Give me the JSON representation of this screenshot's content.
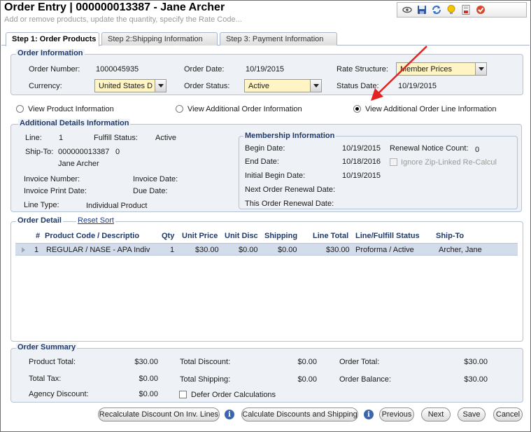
{
  "window": {
    "title": "Order Entry | 000000013387 - Jane Archer",
    "subtitle": "Add or remove products, update the quantity, specify the Rate Code..."
  },
  "toolbar": {
    "icons": [
      "view-icon",
      "save-icon",
      "refresh-icon",
      "lightbulb-icon",
      "report-icon",
      "ok-icon"
    ]
  },
  "tabs": [
    {
      "label": "Step 1: Order Products"
    },
    {
      "label": "Step 2:Shipping Information"
    },
    {
      "label": "Step 3: Payment Information"
    }
  ],
  "order_info": {
    "legend": "Order Information",
    "order_number_label": "Order Number:",
    "order_number": "1000045935",
    "order_date_label": "Order Date:",
    "order_date": "10/19/2015",
    "rate_structure_label": "Rate Structure:",
    "rate_structure": "Member Prices",
    "currency_label": "Currency:",
    "currency": "United States D",
    "order_status_label": "Order Status:",
    "order_status": "Active",
    "status_date_label": "Status Date:",
    "status_date": "10/19/2015"
  },
  "view_options": {
    "product": "View Product Information",
    "additional_order": "View Additional Order Information",
    "additional_line": "View Additional Order Line Information",
    "selected": "additional_line"
  },
  "additional_details": {
    "legend": "Additional Details Information",
    "line_label": "Line:",
    "line": "1",
    "fulfill_status_label": "Fulfill Status:",
    "fulfill_status": "Active",
    "ship_to_label": "Ship-To:",
    "ship_to_id": "000000013387",
    "ship_to_num": "0",
    "ship_to_name": "Jane Archer",
    "invoice_number_label": "Invoice Number:",
    "invoice_date_label": "Invoice Date:",
    "invoice_print_date_label": "Invoice Print Date:",
    "due_date_label": "Due Date:",
    "line_type_label": "Line Type:",
    "line_type": "Individual Product"
  },
  "membership": {
    "legend": "Membership Information",
    "begin_date_label": "Begin Date:",
    "begin_date": "10/19/2015",
    "end_date_label": "End Date:",
    "end_date": "10/18/2016",
    "initial_begin_label": "Initial Begin Date:",
    "initial_begin": "10/19/2015",
    "next_renewal_label": "Next Order Renewal Date:",
    "this_renewal_label": "This Order Renewal Date:",
    "renewal_count_label": "Renewal Notice Count:",
    "renewal_count": "0",
    "ignore_zip_label": "Ignore Zip-Linked Re-Calcul"
  },
  "order_detail": {
    "legend": "Order Detail",
    "reset_sort": "Reset Sort",
    "columns": [
      "#",
      "Product Code / Descriptio",
      "Qty",
      "Unit Price",
      "Unit Disc",
      "Shipping",
      "Line Total",
      "Line/Fulfill Status",
      "Ship-To"
    ],
    "rows": [
      [
        "1",
        "REGULAR / NASE - APA Indiv",
        "1",
        "$30.00",
        "$0.00",
        "$0.00",
        "$30.00",
        "Proforma / Active",
        "Archer, Jane"
      ]
    ]
  },
  "order_summary": {
    "legend": "Order Summary",
    "product_total_label": "Product Total:",
    "product_total": "$30.00",
    "total_discount_label": "Total Discount:",
    "total_discount": "$0.00",
    "order_total_label": "Order Total:",
    "order_total": "$30.00",
    "total_tax_label": "Total Tax:",
    "total_tax": "$0.00",
    "total_shipping_label": "Total Shipping:",
    "total_shipping": "$0.00",
    "order_balance_label": "Order Balance:",
    "order_balance": "$30.00",
    "agency_discount_label": "Agency Discount:",
    "agency_discount": "$0.00",
    "defer_label": "Defer Order Calculations"
  },
  "buttons": {
    "recalc": "Recalculate Discount On Inv. Lines",
    "calc": "Calculate Discounts and Shipping",
    "previous": "Previous",
    "next": "Next",
    "save": "Save",
    "cancel": "Cancel",
    "info": "i"
  },
  "colors": {
    "accent_arrow": "#e32222",
    "legend_text": "#1e3a6b",
    "combo_bg": "#fff5c4"
  }
}
